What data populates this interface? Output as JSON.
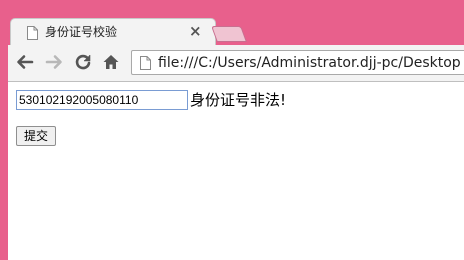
{
  "tab": {
    "title": "身份证号校验",
    "close_glyph": "×",
    "icon": "page-icon"
  },
  "toolbar": {
    "back_icon": "arrow-left-icon",
    "forward_icon": "arrow-right-icon",
    "reload_icon": "reload-icon",
    "home_icon": "home-icon",
    "url": "file:///C:/Users/Administrator.djj-pc/Desktop"
  },
  "form": {
    "id_input_value": "530102192005080110",
    "error_message": "身份证号非法!",
    "submit_label": "提交"
  },
  "colors": {
    "window_frame": "#e8608c",
    "toolbar_bg": "#f3f3f3",
    "page_bg": "#ffffff"
  }
}
